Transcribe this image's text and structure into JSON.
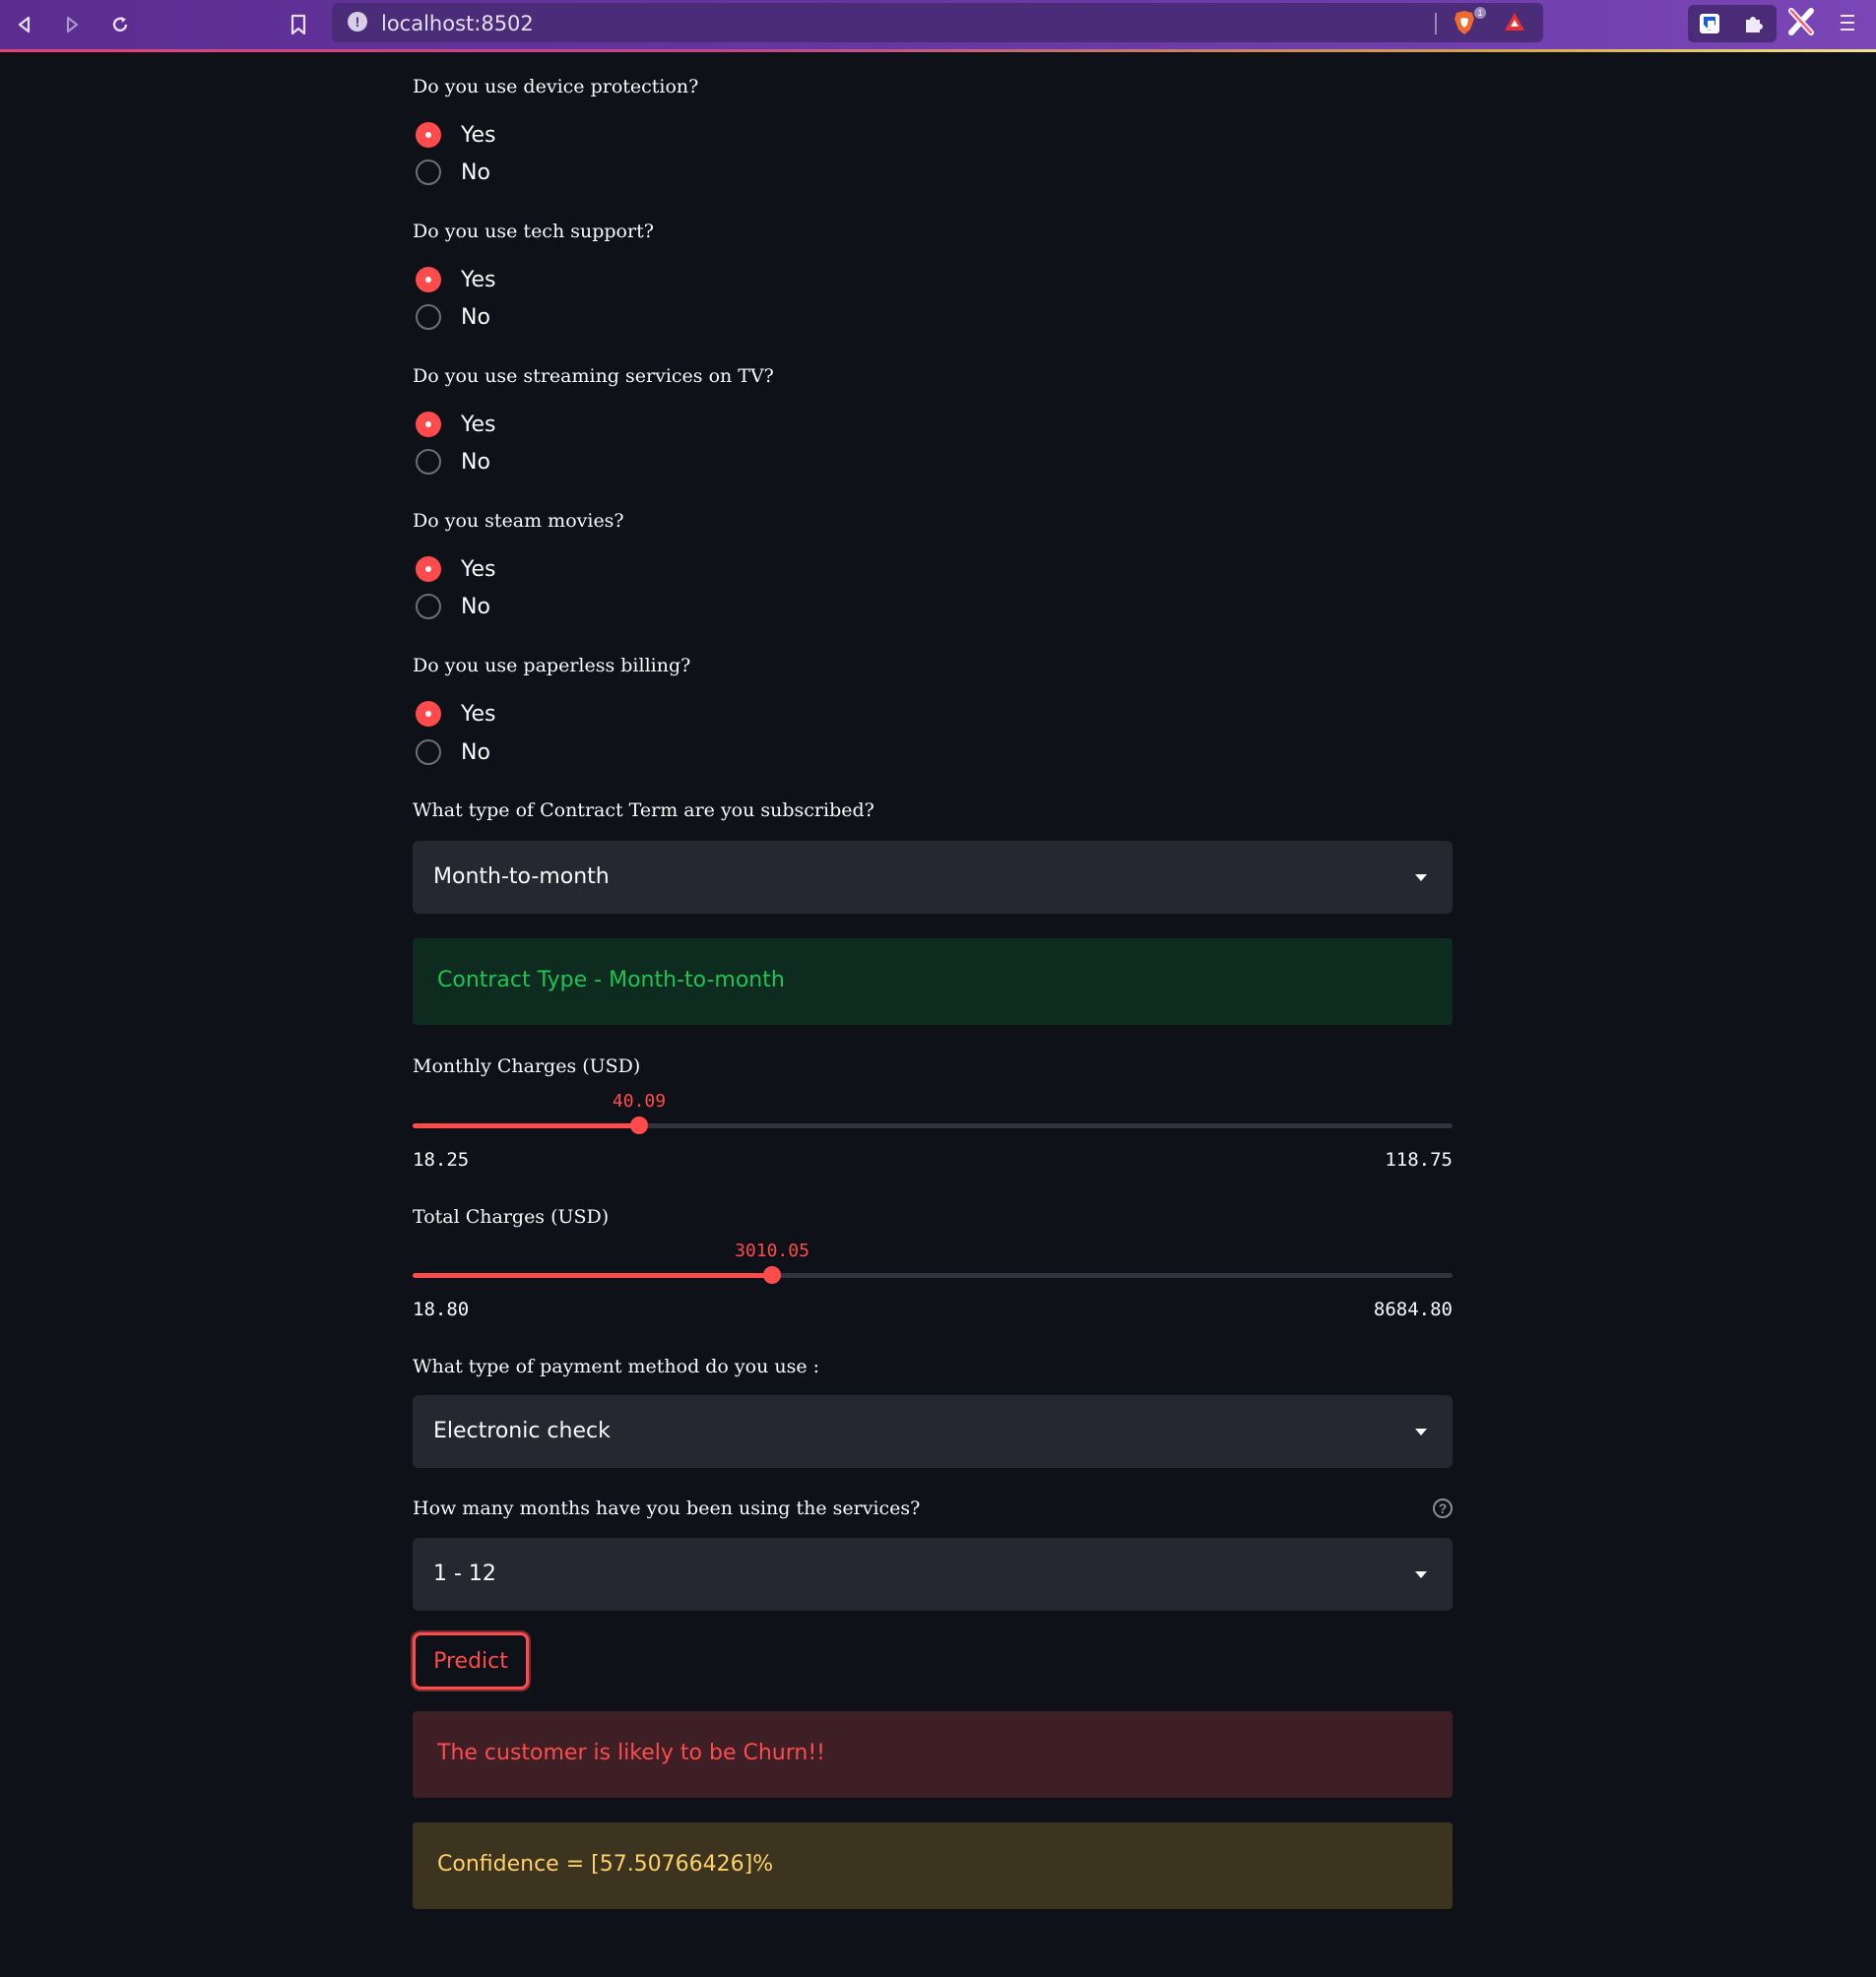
{
  "browser": {
    "url": "localhost:8502",
    "info_icon": "info-icon"
  },
  "questions": [
    {
      "label": "Do you use device protection?",
      "options": [
        "Yes",
        "No"
      ],
      "selected": "Yes"
    },
    {
      "label": "Do you use tech support?",
      "options": [
        "Yes",
        "No"
      ],
      "selected": "Yes"
    },
    {
      "label": "Do you use streaming services on TV?",
      "options": [
        "Yes",
        "No"
      ],
      "selected": "Yes"
    },
    {
      "label": "Do you steam movies?",
      "options": [
        "Yes",
        "No"
      ],
      "selected": "Yes"
    },
    {
      "label": "Do you use paperless billing?",
      "options": [
        "Yes",
        "No"
      ],
      "selected": "Yes"
    }
  ],
  "contract": {
    "label": "What type of Contract Term are you subscribed?",
    "value": "Month-to-month",
    "info": "Contract Type - Month-to-month"
  },
  "monthly_charges": {
    "label": "Monthly Charges (USD)",
    "value": "40.09",
    "min": "18.25",
    "max": "118.75",
    "fraction": 0.2175
  },
  "total_charges": {
    "label": "Total Charges (USD)",
    "value": "3010.05",
    "min": "18.80",
    "max": "8684.80",
    "fraction": 0.3452
  },
  "payment": {
    "label": "What type of payment method do you use :",
    "value": "Electronic check"
  },
  "tenure": {
    "label": "How many months have you been using the services?",
    "value": "1 - 12",
    "help": "?"
  },
  "predict_label": "Predict",
  "result": {
    "error": "The customer is likely to be Churn!!",
    "warning": "Confidence = [57.50766426]%"
  },
  "colors": {
    "accent": "#ff4b4b",
    "background": "#0e1117",
    "success_bg": "#0d2b1e",
    "success_text": "#21c354",
    "error_bg": "#3e1f25",
    "error_text": "#ff4b4b",
    "warning_bg": "#3d3420",
    "warning_text": "#ffd16a"
  }
}
